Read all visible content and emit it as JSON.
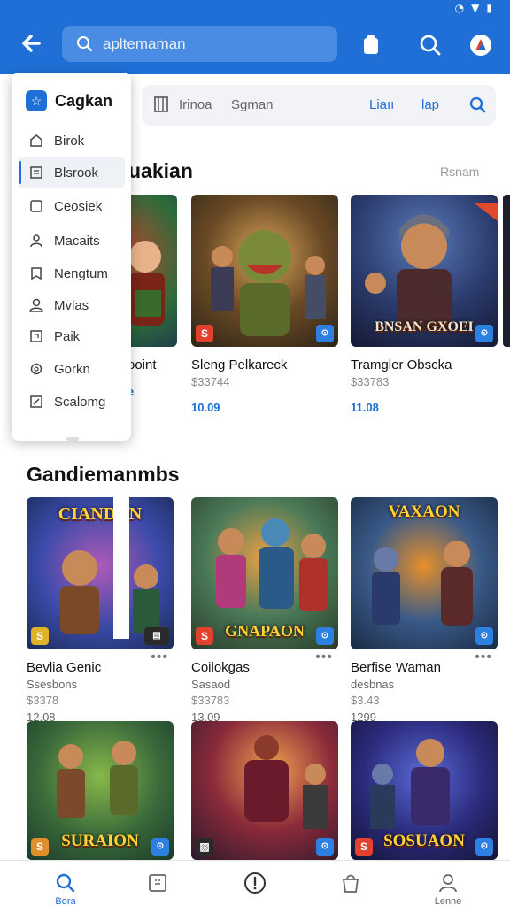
{
  "status_bar": {
    "icons": [
      "signal-icon",
      "wifi-icon",
      "battery-icon"
    ]
  },
  "header": {
    "search": {
      "value": "apltemaman",
      "placeholder": ""
    },
    "icons": [
      "back-arrow-icon",
      "search-icon",
      "clipboard-icon",
      "magnify-icon",
      "profile-icon"
    ]
  },
  "subbar": {
    "item1": "Irinoa",
    "item2": "Sgman",
    "link1": "Liaıı",
    "link2": "lap"
  },
  "menu": {
    "app_name": "Cagkan",
    "items": [
      {
        "label": "Birok",
        "icon": "home-icon"
      },
      {
        "label": "Blsrook",
        "icon": "list-icon"
      },
      {
        "label": "Ceosiek",
        "icon": "square-icon"
      },
      {
        "label": "Macaits",
        "icon": "user-icon"
      },
      {
        "label": "Nengtum",
        "icon": "bookmark-icon"
      },
      {
        "label": "Mvlas",
        "icon": "person-icon"
      },
      {
        "label": "Paik",
        "icon": "box-icon"
      },
      {
        "label": "Gorkn",
        "icon": "gear-icon"
      },
      {
        "label": "Scalomg",
        "icon": "edit-icon"
      }
    ]
  },
  "section1": {
    "title": "uakian",
    "more": "Rsnam",
    "cards": [
      {
        "title": "ooint",
        "price": "",
        "rating": "e"
      },
      {
        "title": "Sleng Pelkareck",
        "price": "$33744",
        "rating": "10.09"
      },
      {
        "title": "Tramgler Obscka",
        "price": "$33783",
        "rating": "11.08"
      }
    ]
  },
  "section2": {
    "title": "Gandiemanmbs",
    "more": "",
    "cards": [
      {
        "title": "Bevlia Genic",
        "sub": "Ssesbons",
        "price": "$3378",
        "rating": "12.08",
        "banner": "CIANDAN"
      },
      {
        "title": "Coilokgas",
        "sub": "Sasaod",
        "price": "$33783",
        "rating": "13.09",
        "banner": "GNAPAON"
      },
      {
        "title": "Berfise Waman",
        "sub": "desbnas",
        "price": "$3.43",
        "rating": "1299",
        "banner": "VAXAON"
      }
    ]
  },
  "section3": {
    "cards": [
      {
        "banner": "SURAION"
      },
      {
        "banner": ""
      },
      {
        "banner": "SOSUAON"
      }
    ]
  },
  "section1_extra": {
    "banner": "BNSAN GXOEI"
  },
  "bottom_nav": [
    {
      "label": "Bora",
      "icon": "search-icon"
    },
    {
      "label": "",
      "icon": "grid-icon"
    },
    {
      "label": "",
      "icon": "alert-icon"
    },
    {
      "label": "",
      "icon": "bag-icon"
    },
    {
      "label": "Lenne",
      "icon": "account-icon"
    }
  ],
  "colors": {
    "primary": "#1f6fd6",
    "banner_text": "#ffd43a"
  }
}
